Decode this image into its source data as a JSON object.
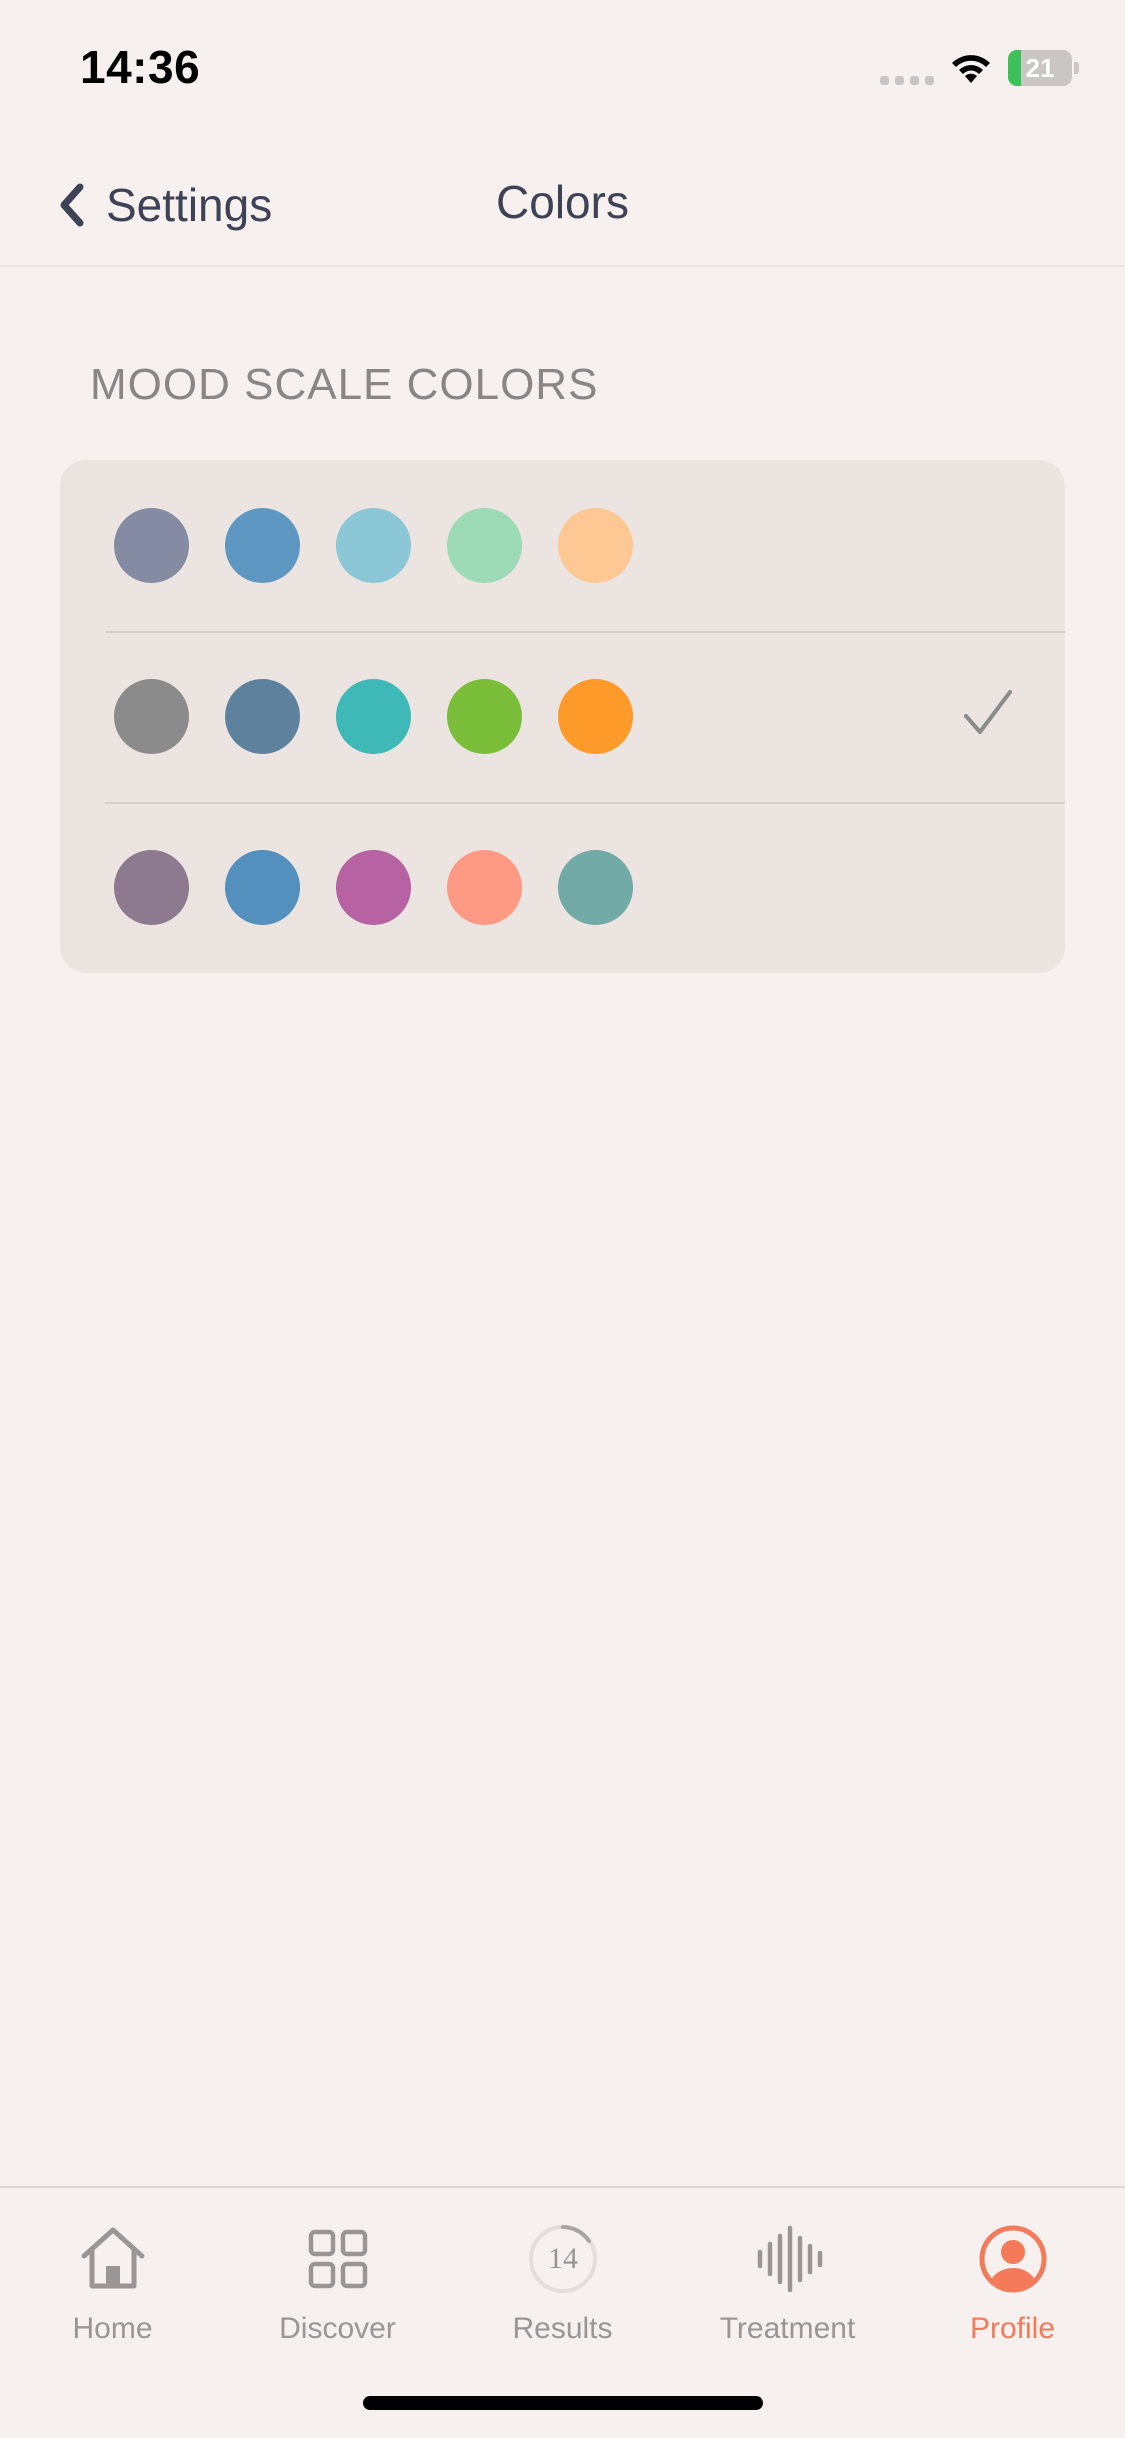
{
  "status_bar": {
    "time": "14:36",
    "battery_level": "21",
    "battery_fraction": 0.21
  },
  "nav": {
    "back_label": "Settings",
    "title": "Colors"
  },
  "section": {
    "header": "MOOD SCALE COLORS"
  },
  "color_options": [
    {
      "colors": [
        "#858BA3",
        "#5F97C3",
        "#8BC7D6",
        "#9DDAB6",
        "#FDC894"
      ],
      "selected": false
    },
    {
      "colors": [
        "#8B8B8B",
        "#5E829D",
        "#3FB9B7",
        "#7BBE3A",
        "#FE9A2A"
      ],
      "selected": true
    },
    {
      "colors": [
        "#8E7A8F",
        "#5390BE",
        "#B762A2",
        "#FE9A84",
        "#72AAA8"
      ],
      "selected": false
    }
  ],
  "tabs": [
    {
      "label": "Home",
      "icon": "home-icon",
      "active": false
    },
    {
      "label": "Discover",
      "icon": "grid-icon",
      "active": false
    },
    {
      "label": "Results",
      "icon": "results-progress-icon",
      "badge": "14",
      "active": false
    },
    {
      "label": "Treatment",
      "icon": "waveform-icon",
      "active": false
    },
    {
      "label": "Profile",
      "icon": "profile-icon",
      "active": true
    }
  ],
  "theme": {
    "accent": "#F47A5A",
    "text": "#3E4257",
    "muted": "#9A9696",
    "background": "#F6F0EE",
    "card": "#ECE4E0"
  }
}
